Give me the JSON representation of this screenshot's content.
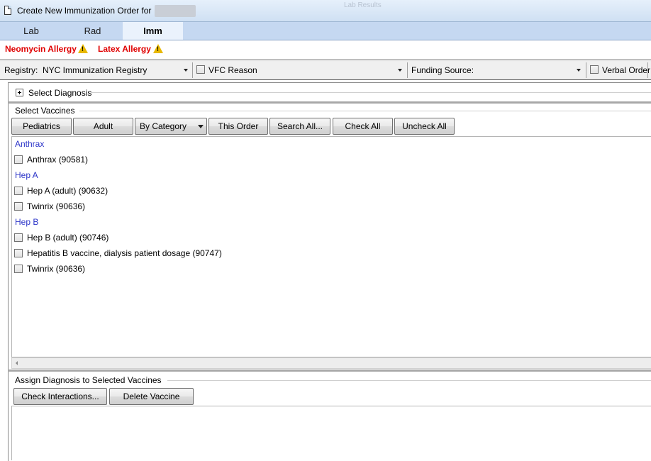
{
  "window": {
    "title": "Create New Immunization Order for",
    "ghost_text": "Lab Results"
  },
  "tabs": [
    {
      "label": "Lab",
      "active": false
    },
    {
      "label": "Rad",
      "active": false
    },
    {
      "label": "Imm",
      "active": true
    }
  ],
  "allergies": [
    {
      "label": "Neomycin Allergy",
      "color": "#e00000"
    },
    {
      "label": "Latex Allergy",
      "color": "#e00000"
    }
  ],
  "options": {
    "registry_label": "Registry:",
    "registry_value": "NYC Immunization Registry",
    "vfc_label": "VFC Reason",
    "vfc_checked": false,
    "vfc_value": "",
    "funding_label": "Funding Source:",
    "funding_value": "",
    "verbal_label": "Verbal Order",
    "verbal_checked": false
  },
  "diagnosis": {
    "expander_label": "Select Diagnosis"
  },
  "vaccines": {
    "group_title": "Select Vaccines",
    "buttons": {
      "pediatrics": "Pediatrics",
      "adult": "Adult",
      "by_category": "By Category",
      "this_order": "This Order",
      "search_all": "Search All...",
      "check_all": "Check All",
      "uncheck_all": "Uncheck All"
    },
    "categories": [
      {
        "name": "Anthrax",
        "items": [
          {
            "label": "Anthrax (90581)",
            "checked": false
          }
        ]
      },
      {
        "name": "Hep A",
        "items": [
          {
            "label": "Hep A (adult) (90632)",
            "checked": false
          },
          {
            "label": "Twinrix (90636)",
            "checked": false
          }
        ]
      },
      {
        "name": "Hep B",
        "items": [
          {
            "label": "Hep B (adult) (90746)",
            "checked": false
          },
          {
            "label": "Hepatitis B vaccine, dialysis patient dosage (90747)",
            "checked": false
          },
          {
            "label": "Twinrix (90636)",
            "checked": false
          }
        ]
      }
    ]
  },
  "assign": {
    "group_title": "Assign Diagnosis to Selected Vaccines",
    "check_interactions": "Check Interactions...",
    "delete_vaccine": "Delete Vaccine"
  },
  "colors": {
    "category_link": "#2b34c8",
    "tab_bar": "#c5d8f1",
    "warning": "#e8b800"
  }
}
